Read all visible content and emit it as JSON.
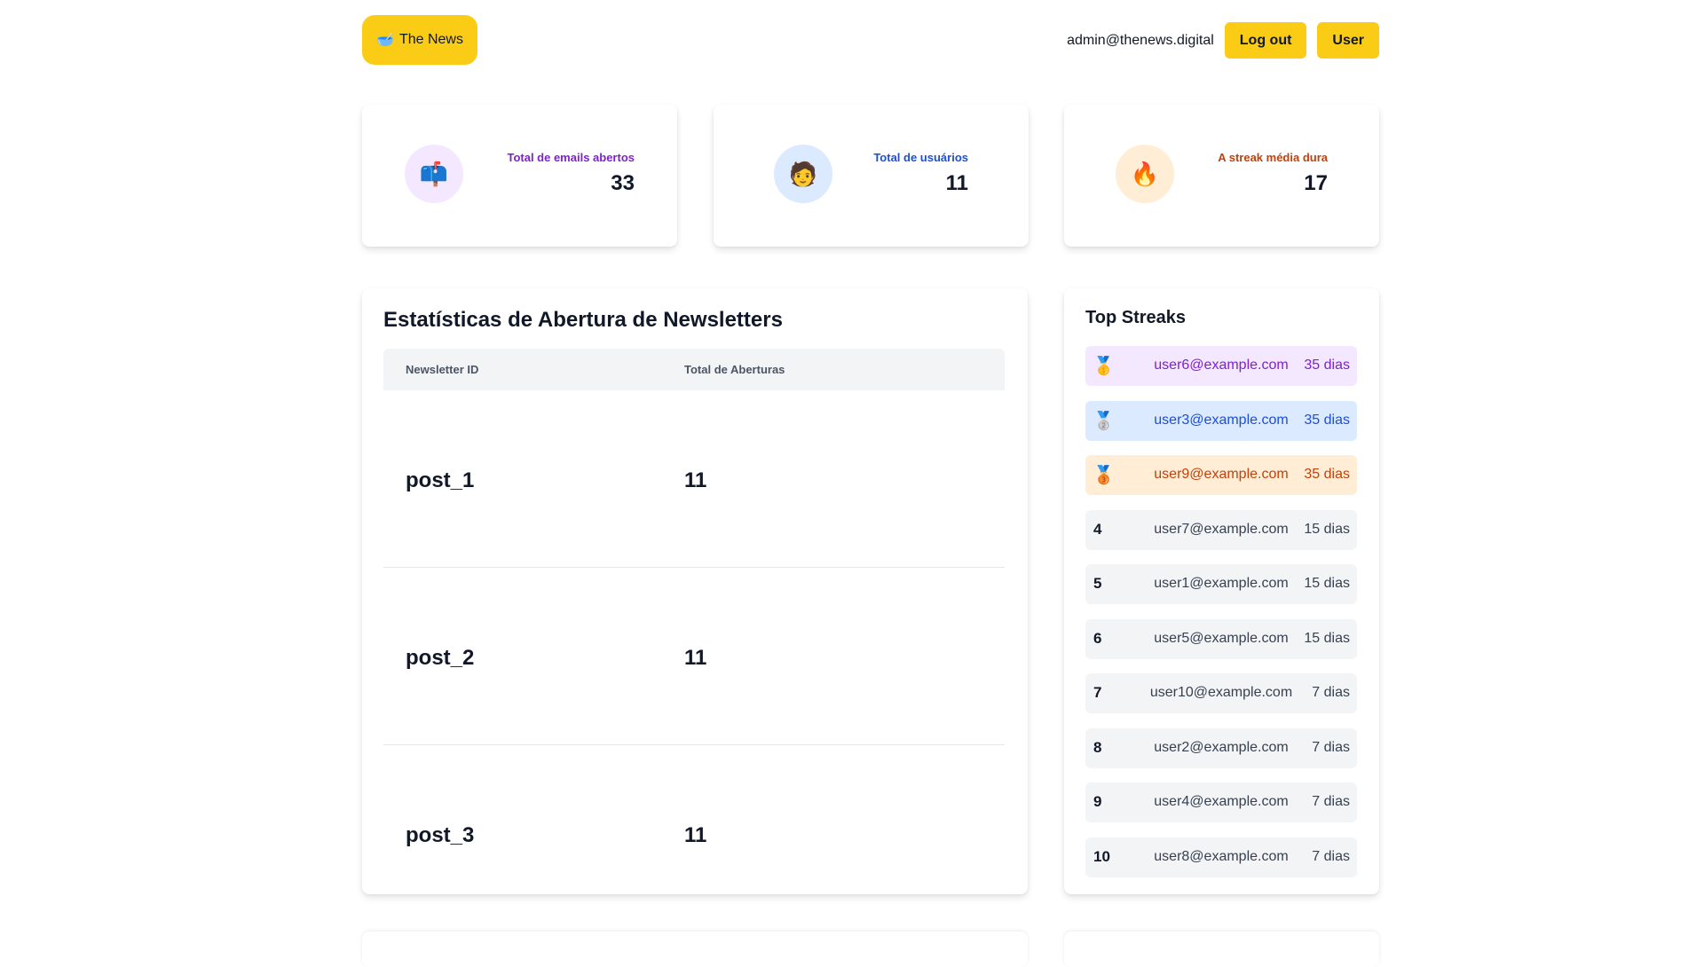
{
  "header": {
    "brand_icon": "sunrise-bowl-icon",
    "brand_emoji": "🥣",
    "brand_label": "The News",
    "admin_email": "admin@thenews.digital",
    "logout_label": "Log out",
    "user_label": "User",
    "accent": "#FACC15"
  },
  "stats": [
    {
      "icon": "mailbox-icon",
      "emoji": "📫",
      "label": "Total de emails abertos",
      "value": "33",
      "color": "#7E22CE",
      "bg": "#F3E8FF"
    },
    {
      "icon": "user-face-icon",
      "emoji": "🧑",
      "label": "Total de usuários",
      "value": "11",
      "color": "#1D4ED8",
      "bg": "#DBEAFE"
    },
    {
      "icon": "fire-icon",
      "emoji": "🔥",
      "label": "A streak média dura",
      "value": "17",
      "color": "#C2410C",
      "bg": "#FFEDD5"
    }
  ],
  "newsletter_stats": {
    "title": "Estatísticas de Abertura de Newsletters",
    "columns": [
      "Newsletter ID",
      "Total de Aberturas"
    ],
    "rows": [
      {
        "id": "post_1",
        "total": "11"
      },
      {
        "id": "post_2",
        "total": "11"
      },
      {
        "id": "post_3",
        "total": "11"
      }
    ]
  },
  "top_streaks": {
    "title": "Top Streaks",
    "items": [
      {
        "rank": "",
        "medal": "🥇",
        "icon": "gold-medal-icon",
        "email": "user6@example.com",
        "days": "35 dias",
        "bg": "#F3E8FF",
        "color": "#7E22CE"
      },
      {
        "rank": "",
        "medal": "🥈",
        "icon": "silver-medal-icon",
        "email": "user3@example.com",
        "days": "35 dias",
        "bg": "#DBEAFE",
        "color": "#1D4ED8"
      },
      {
        "rank": "",
        "medal": "🥉",
        "icon": "bronze-medal-icon",
        "email": "user9@example.com",
        "days": "35 dias",
        "bg": "#FFEDD5",
        "color": "#C2410C"
      },
      {
        "rank": "4",
        "email": "user7@example.com",
        "days": "15 dias",
        "bg": "#F3F4F6",
        "color": "#374151"
      },
      {
        "rank": "5",
        "email": "user1@example.com",
        "days": "15 dias",
        "bg": "#F3F4F6",
        "color": "#374151"
      },
      {
        "rank": "6",
        "email": "user5@example.com",
        "days": "15 dias",
        "bg": "#F3F4F6",
        "color": "#374151"
      },
      {
        "rank": "7",
        "email": "user10@example.com",
        "days": "7 dias",
        "bg": "#F3F4F6",
        "color": "#374151"
      },
      {
        "rank": "8",
        "email": "user2@example.com",
        "days": "7 dias",
        "bg": "#F3F4F6",
        "color": "#374151"
      },
      {
        "rank": "9",
        "email": "user4@example.com",
        "days": "7 dias",
        "bg": "#F3F4F6",
        "color": "#374151"
      },
      {
        "rank": "10",
        "email": "user8@example.com",
        "days": "7 dias",
        "bg": "#F3F4F6",
        "color": "#374151"
      }
    ]
  }
}
